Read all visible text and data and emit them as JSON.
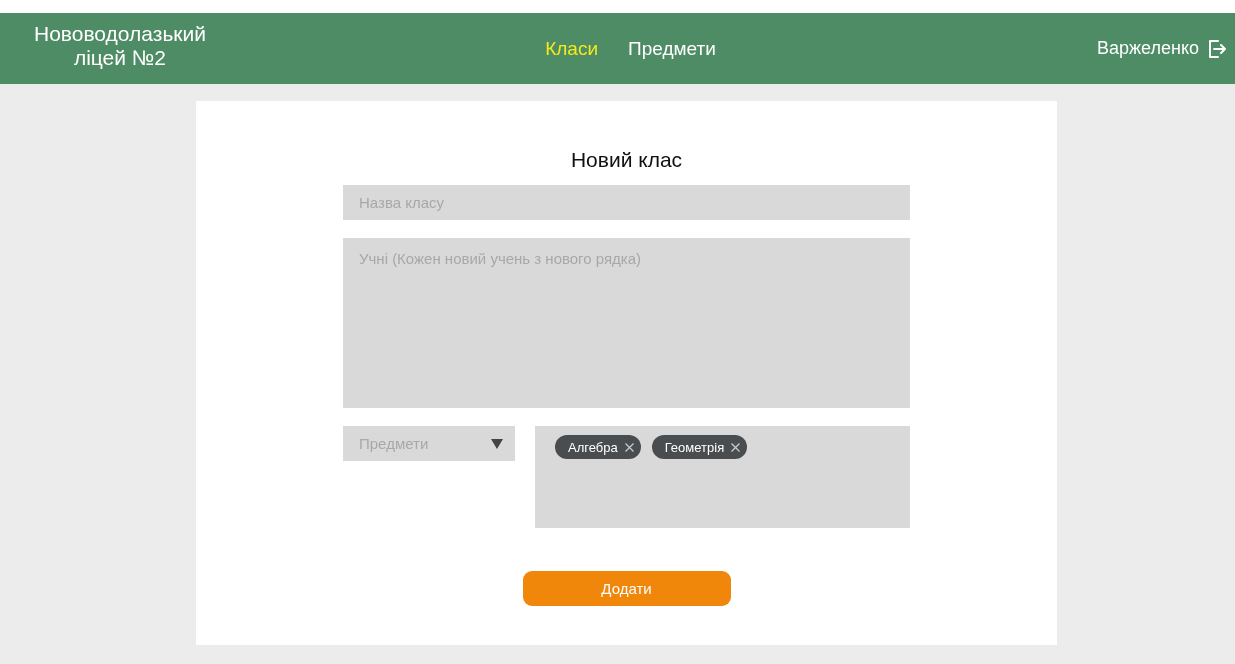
{
  "header": {
    "school_name": "Нововодолазький\nліцей №2",
    "nav": [
      {
        "label": "Класи",
        "selected": true
      },
      {
        "label": "Предмети",
        "selected": false
      }
    ],
    "user": "Варжеленко"
  },
  "form": {
    "title": "Новий клас",
    "class_name": {
      "placeholder": "Назва класу"
    },
    "students": {
      "placeholder": "Учні (Кожен новий учень з нового рядка)"
    },
    "subjects_select": {
      "placeholder": "Предмети"
    },
    "chips": [
      {
        "label": "Алгебра"
      },
      {
        "label": "Геометрія"
      }
    ],
    "submit": "Додати"
  }
}
